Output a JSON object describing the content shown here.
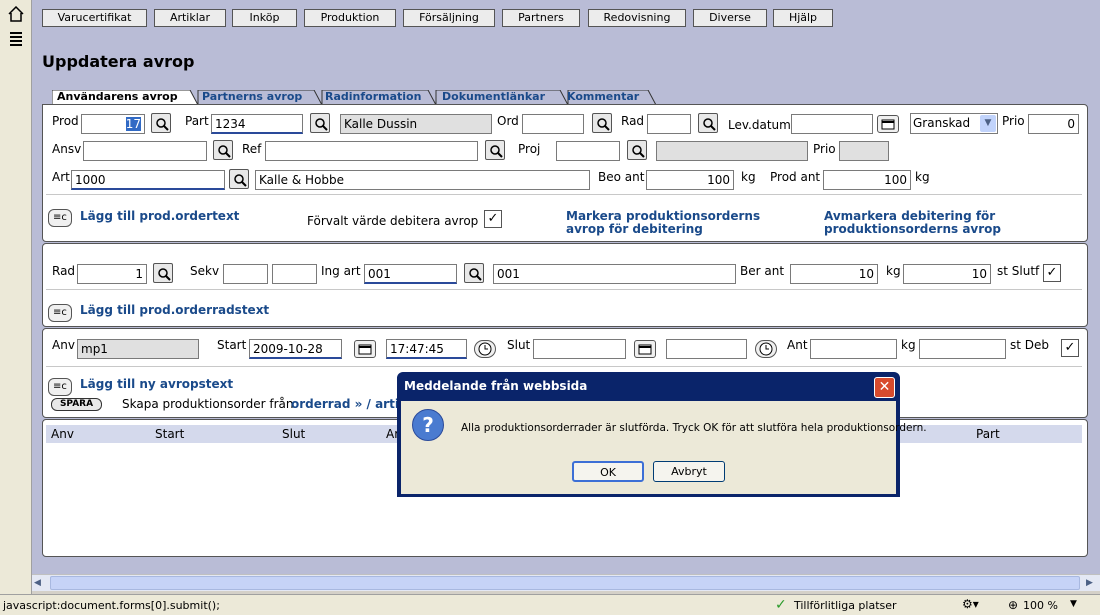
{
  "menu": [
    "Varucertifikat",
    "Artiklar",
    "Inköp",
    "Produktion",
    "Försäljning",
    "Partners",
    "Redovisning",
    "Diverse",
    "Hjälp"
  ],
  "page_title": "Uppdatera avrop",
  "tabs": [
    "Användarens avrop",
    "Partnerns avrop",
    "Radinformation",
    "Dokumentlänkar",
    "Kommentar"
  ],
  "section1": {
    "prod_label": "Prod",
    "prod_value": "17",
    "part_label": "Part",
    "part_value": "1234",
    "part_name": "Kalle Dussin",
    "ord_label": "Ord",
    "ord_value": "",
    "rad_label": "Rad",
    "rad_value": "",
    "levdatum_label": "Lev.datum",
    "levdatum_value": "",
    "status_value": "Granskad",
    "prio_label": "Prio",
    "prio_value": "0",
    "ansv_label": "Ansv",
    "ansv_value": "",
    "ref_label": "Ref",
    "ref_value": "",
    "proj_label": "Proj",
    "proj_value": "",
    "prio2_label": "Prio",
    "prio2_value": "",
    "art_label": "Art",
    "art_value": "1000",
    "art_name": "Kalle & Hobbe",
    "beo_ant_label": "Beo ant",
    "beo_ant_value": "100",
    "kg1": "kg",
    "prod_ant_label": "Prod ant",
    "prod_ant_value": "100",
    "kg2": "kg",
    "add_text_link": "Lägg till prod.ordertext",
    "default_deb_label": "Förvalt värde debitera avrop",
    "mark_link_1": "Markera produktionsorderns",
    "mark_link_2": "avrop för debitering",
    "unmark_link_1": "Avmarkera debitering för",
    "unmark_link_2": "produktionsorderns avrop"
  },
  "section2": {
    "rad_label": "Rad",
    "rad_value": "1",
    "sekv_label": "Sekv",
    "sekv_value1": "",
    "sekv_value2": "",
    "ing_art_label": "Ing art",
    "ing_art_value": "001",
    "ing_art_name": "001",
    "ber_ant_label": "Ber ant",
    "ber_ant_value": "10",
    "kg": "kg",
    "qty2_value": "10",
    "st_slutf_label": "st Slutf",
    "add_row_text_link": "Lägg till prod.orderradstext"
  },
  "section3": {
    "anv_label": "Anv",
    "anv_value": "mp1",
    "start_label": "Start",
    "start_date": "2009-10-28",
    "start_time": "17:47:45",
    "slut_label": "Slut",
    "slut_date": "",
    "slut_time": "",
    "ant_label": "Ant",
    "ant_value": "",
    "kg": "kg",
    "st_value": "",
    "st_deb_label": "st Deb",
    "add_avrop_text_link": "Lägg till ny avropstext",
    "spara_label": "SPARA",
    "create_text": "Skapa produktionsorder från",
    "create_link": "orderrad »  / arti"
  },
  "table": {
    "headers": [
      "Anv",
      "Start",
      "Slut",
      "Ar",
      "Part"
    ]
  },
  "dialog": {
    "title": "Meddelande från webbsida",
    "message": "Alla produktionsorderrader är slutförda. Tryck OK för att slutföra hela produktionsordern.",
    "ok": "OK",
    "cancel": "Avbryt"
  },
  "statusbar": {
    "url": "javascript:document.forms[0].submit();",
    "zone": "Tillförlitliga platser",
    "zoom": "100 %"
  },
  "colors": {
    "link": "#1a4a8a",
    "background": "#b9bcd6",
    "dialog_title": "#0a246a"
  }
}
